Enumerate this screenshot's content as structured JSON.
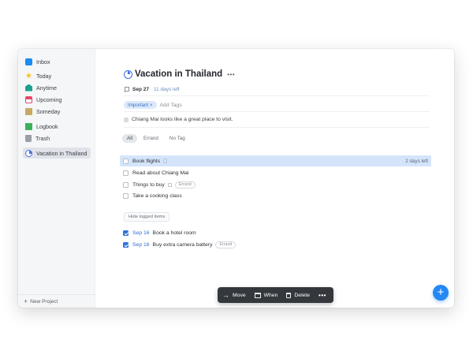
{
  "sidebar": {
    "items": [
      {
        "label": "Inbox",
        "icon": "inbox-icon"
      },
      {
        "label": "Today",
        "icon": "star-icon"
      },
      {
        "label": "Anytime",
        "icon": "stack-icon"
      },
      {
        "label": "Upcoming",
        "icon": "calendar-icon"
      },
      {
        "label": "Someday",
        "icon": "box-icon"
      },
      {
        "label": "Logbook",
        "icon": "logbook-icon"
      },
      {
        "label": "Trash",
        "icon": "trash-icon"
      },
      {
        "label": "Vacation in Thailand",
        "icon": "project-pie-icon",
        "active": true
      }
    ],
    "new_project": "New Project"
  },
  "project": {
    "title": "Vacation in Thailand",
    "more": "•••",
    "deadline_date": "Sep 27",
    "deadline_left": "11 days left",
    "tag": "Important",
    "tag_remove": "×",
    "add_tags": "Add Tags",
    "note": "Chiang Mai looks like a great place to visit."
  },
  "filters": [
    "All",
    "Errand",
    "No Tag"
  ],
  "tasks": [
    {
      "title": "Book flights",
      "right": "2 days left",
      "selected": true
    },
    {
      "title": "Read about Chiang Mai"
    },
    {
      "title": "Things to buy",
      "tag": "Errand"
    },
    {
      "title": "Take a cooking class"
    }
  ],
  "hide_logged": "Hide logged items",
  "logged": [
    {
      "date": "Sep 16",
      "title": "Book a hotel room"
    },
    {
      "date": "Sep 16",
      "title": "Buy extra camera battery",
      "tag": "Errand"
    }
  ],
  "toolbar": {
    "move": "Move",
    "move_icon": "→",
    "when": "When",
    "delete": "Delete",
    "more": "•••"
  },
  "fab": "+",
  "colors": {
    "accent": "#2589f3",
    "selection": "#d4e5fb",
    "toolbar": "#34383d",
    "sidebar": "#f5f6f8"
  }
}
